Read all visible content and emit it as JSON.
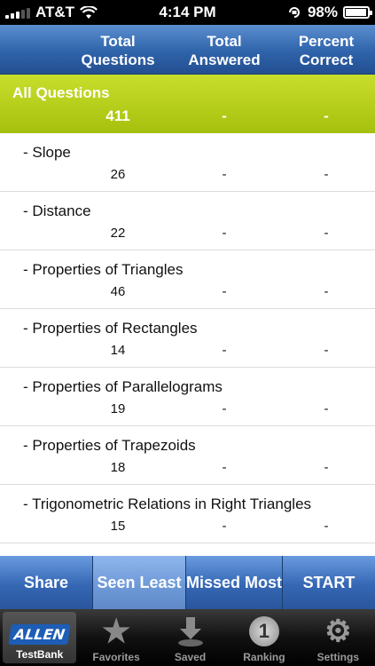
{
  "status": {
    "carrier": "AT&T",
    "time": "4:14 PM",
    "battery": "98%",
    "battery_level": 0.98
  },
  "columns": {
    "total_questions": [
      "Total",
      "Questions"
    ],
    "total_answered": [
      "Total",
      "Answered"
    ],
    "percent_correct": [
      "Percent",
      "Correct"
    ]
  },
  "all": {
    "label": "All Questions",
    "total": "411",
    "answered": "-",
    "percent": "-"
  },
  "rows": [
    {
      "label": "- Slope",
      "total": "26",
      "answered": "-",
      "percent": "-"
    },
    {
      "label": "- Distance",
      "total": "22",
      "answered": "-",
      "percent": "-"
    },
    {
      "label": "- Properties of Triangles",
      "total": "46",
      "answered": "-",
      "percent": "-"
    },
    {
      "label": "- Properties of Rectangles",
      "total": "14",
      "answered": "-",
      "percent": "-"
    },
    {
      "label": "- Properties of Parallelograms",
      "total": "19",
      "answered": "-",
      "percent": "-"
    },
    {
      "label": "- Properties of Trapezoids",
      "total": "18",
      "answered": "-",
      "percent": "-"
    },
    {
      "label": "- Trigonometric Relations in Right Triangles",
      "total": "15",
      "answered": "-",
      "percent": "-"
    }
  ],
  "actions": {
    "share": "Share",
    "seen_least": "Seen Least",
    "missed_most": "Missed Most",
    "start": "START"
  },
  "tabs": {
    "testbank": {
      "label": "TestBank",
      "logo_text": "ALLEN",
      "icon": "allen-logo"
    },
    "favorites": {
      "label": "Favorites",
      "icon": "star-icon"
    },
    "saved": {
      "label": "Saved",
      "icon": "download-icon"
    },
    "ranking": {
      "label": "Ranking",
      "icon": "ranking-icon",
      "icon_text": "1"
    },
    "settings": {
      "label": "Settings",
      "icon": "gear-icon"
    }
  }
}
